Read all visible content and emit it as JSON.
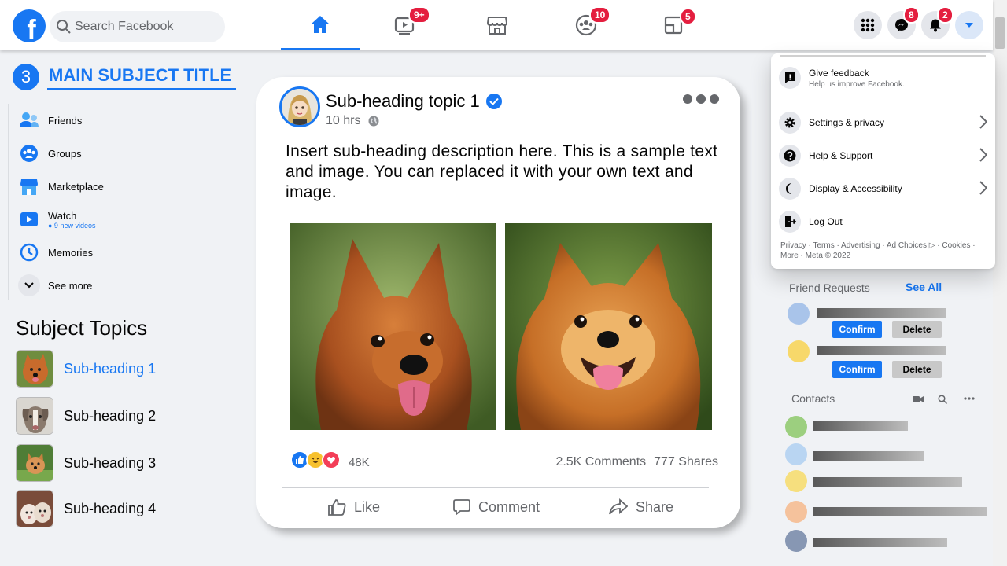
{
  "header": {
    "logo_letter": "f",
    "search_placeholder": "Search Facebook",
    "badges": {
      "watch": "9+",
      "groups": "10",
      "gaming": "5",
      "messenger": "8",
      "notifications": "2"
    }
  },
  "title": {
    "number": "3",
    "text": "MAIN SUBJECT TITLE"
  },
  "left_nav": [
    {
      "label": "Friends"
    },
    {
      "label": "Groups"
    },
    {
      "label": "Marketplace"
    },
    {
      "label": "Watch",
      "sub": "● 9 new videos"
    },
    {
      "label": "Memories"
    },
    {
      "label": "See more"
    }
  ],
  "subject_topics": {
    "heading": "Subject Topics",
    "items": [
      "Sub-heading 1",
      "Sub-heading 2",
      "Sub-heading 3",
      "Sub-heading 4"
    ]
  },
  "post": {
    "title": "Sub-heading topic 1",
    "time": "10 hrs",
    "description": "Insert sub-heading description here. This is a sample text and image. You can replaced it with your own text and image.",
    "reaction_count": "48K",
    "comments": "2.5K Comments",
    "shares": "777 Shares",
    "actions": {
      "like": "Like",
      "comment": "Comment",
      "share": "Share"
    }
  },
  "dropdown": {
    "feedback_title": "Give feedback",
    "feedback_sub": "Help us improve Facebook.",
    "items": [
      "Settings & privacy",
      "Help & Support",
      "Display & Accessibility",
      "Log Out"
    ],
    "footer": "Privacy · Terms · Advertising · Ad Choices ▷ · Cookies · More · Meta © 2022"
  },
  "friend_requests": {
    "heading": "Friend Requests",
    "see_all": "See All",
    "confirm": "Confirm",
    "delete": "Delete",
    "avatar_colors": [
      "#a9c4ea",
      "#f7d86a"
    ]
  },
  "contacts": {
    "heading": "Contacts",
    "avatar_colors": [
      "#9ccf7f",
      "#b9d5f2",
      "#f6df7e",
      "#f5c29c",
      "#8797b3"
    ]
  },
  "colors": {
    "brand": "#1877f2",
    "badge": "#e41e3f"
  }
}
